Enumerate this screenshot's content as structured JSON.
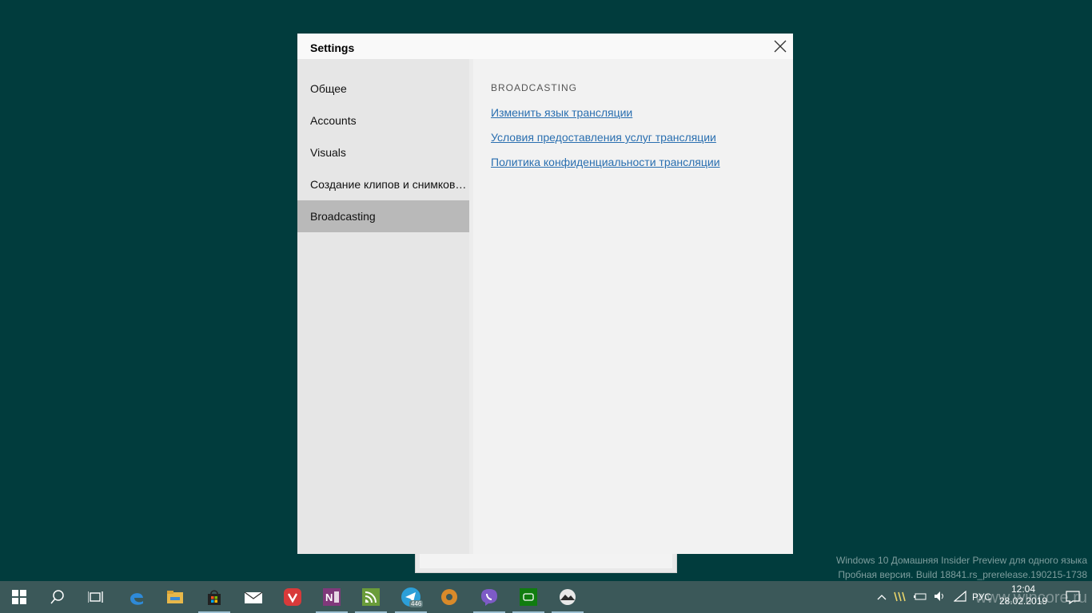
{
  "dialog": {
    "title": "Settings"
  },
  "nav": {
    "items": [
      {
        "label": "Общее"
      },
      {
        "label": "Accounts"
      },
      {
        "label": "Visuals"
      },
      {
        "label": "Создание клипов и снимков экрана"
      },
      {
        "label": "Broadcasting",
        "selected": true
      }
    ]
  },
  "content": {
    "section_title": "BROADCASTING",
    "links": [
      {
        "label": "Изменить язык трансляции"
      },
      {
        "label": "Условия предоставления услуг трансляции"
      },
      {
        "label": "Политика конфиденциальности трансляции"
      }
    ]
  },
  "watermark": {
    "line1": "Windows 10 Домашняя Insider Preview для одного языка",
    "line2": "Пробная версия. Build 18841.rs_prerelease.190215-1738",
    "site": "www.wincore.ru"
  },
  "taskbar": {
    "icons": [
      "start-icon",
      "search-icon",
      "task-view-icon",
      "edge-icon",
      "file-explorer-icon",
      "store-icon",
      "mail-icon",
      "vivaldi-icon",
      "onenote-icon",
      "feed-reader-icon",
      "telegram-icon",
      "settings-app-icon",
      "viber-icon",
      "xbox-icon",
      "photos-icon"
    ],
    "telegram_badge": "446",
    "tray": {
      "language": "РУС",
      "time": "12:04",
      "date": "28.02.2019"
    }
  },
  "colors": {
    "desktop": "#013c3d",
    "taskbar": "#3b5859",
    "link": "#2a6fb0",
    "nav_selected": "#b9b9b9"
  }
}
